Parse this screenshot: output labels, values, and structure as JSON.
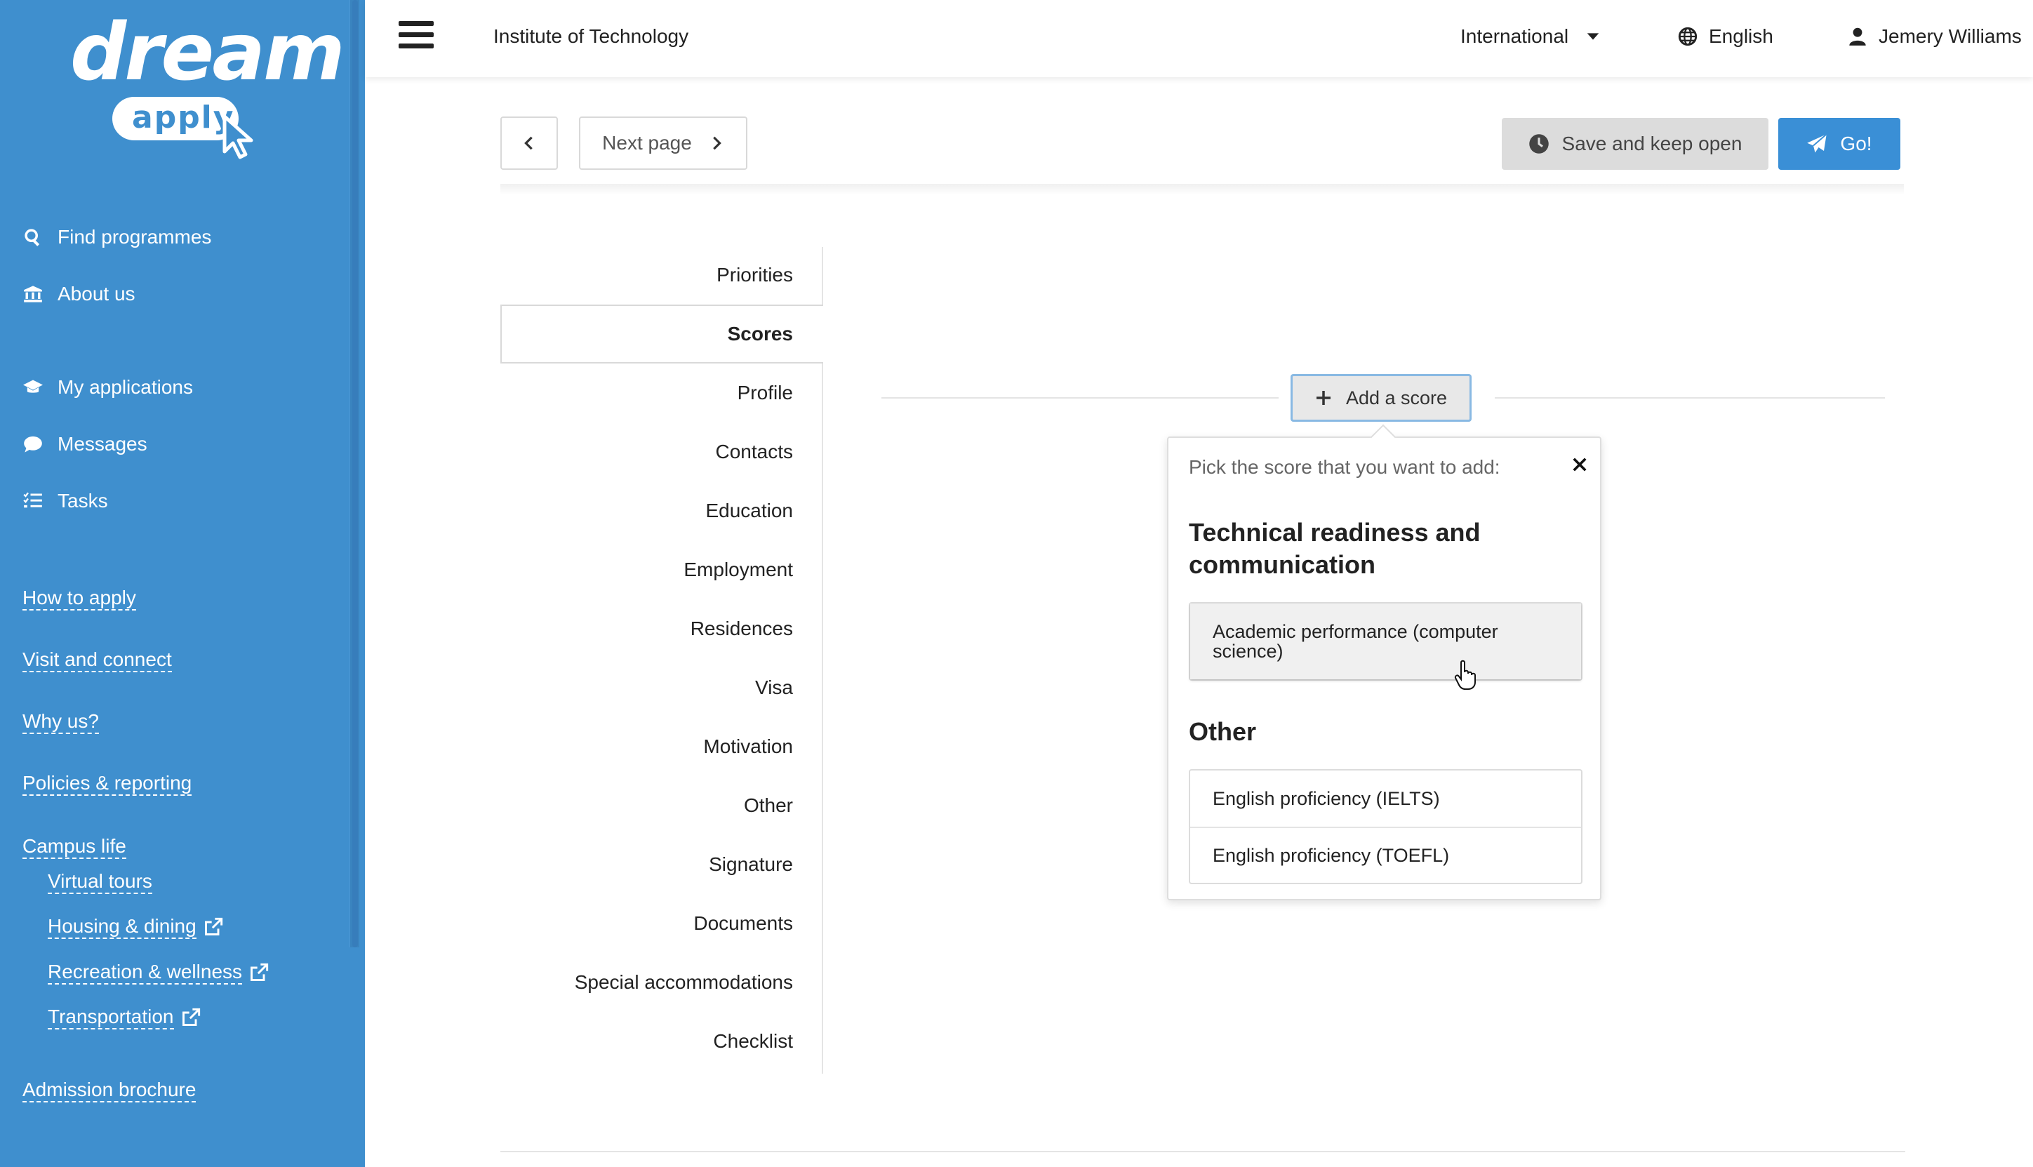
{
  "brand": {
    "logo_word_top": "dream",
    "logo_word_bottom": "apply",
    "sidebar_color": "#3f8fce",
    "accent_color": "#3a8fd6"
  },
  "sidebar": {
    "primary_nav": [
      {
        "label": "Find programmes",
        "icon": "search-icon"
      },
      {
        "label": "About us",
        "icon": "institution-icon"
      }
    ],
    "account_nav": [
      {
        "label": "My applications",
        "icon": "graduation-cap-icon"
      },
      {
        "label": "Messages",
        "icon": "chat-bubble-icon"
      },
      {
        "label": "Tasks",
        "icon": "task-list-icon"
      }
    ],
    "links": {
      "how_to_apply": "How to apply",
      "visit_and_connect": "Visit and connect",
      "why_us": "Why us?",
      "policies": "Policies & reporting",
      "campus_life": "Campus life",
      "virtual_tours": "Virtual tours",
      "housing": "Housing & dining",
      "recreation": "Recreation & wellness",
      "transportation": "Transportation",
      "brochure": "Admission brochure"
    }
  },
  "topbar": {
    "institution": "Institute of Technology",
    "region": "International",
    "language": "English",
    "user": "Jemery Williams"
  },
  "actions": {
    "next_page": "Next page",
    "save_keep_open": "Save and keep open",
    "go": "Go!"
  },
  "tabs": [
    {
      "label": "Priorities"
    },
    {
      "label": "Scores",
      "active": true
    },
    {
      "label": "Profile"
    },
    {
      "label": "Contacts"
    },
    {
      "label": "Education"
    },
    {
      "label": "Employment"
    },
    {
      "label": "Residences"
    },
    {
      "label": "Visa"
    },
    {
      "label": "Motivation"
    },
    {
      "label": "Other"
    },
    {
      "label": "Signature"
    },
    {
      "label": "Documents"
    },
    {
      "label": "Special accommodations"
    },
    {
      "label": "Checklist"
    }
  ],
  "scores": {
    "add_button": "Add a score",
    "popover": {
      "hint": "Pick the score that you want to add:",
      "groups": [
        {
          "heading_line1": "Technical readiness and",
          "heading_line2": "communication",
          "options": [
            {
              "line1": "Academic performance (computer",
              "line2": "science)"
            }
          ]
        },
        {
          "heading_line1": "Other",
          "options": [
            {
              "line1": "English proficiency (IELTS)"
            },
            {
              "line1": "English proficiency (TOEFL)"
            }
          ]
        }
      ]
    }
  }
}
